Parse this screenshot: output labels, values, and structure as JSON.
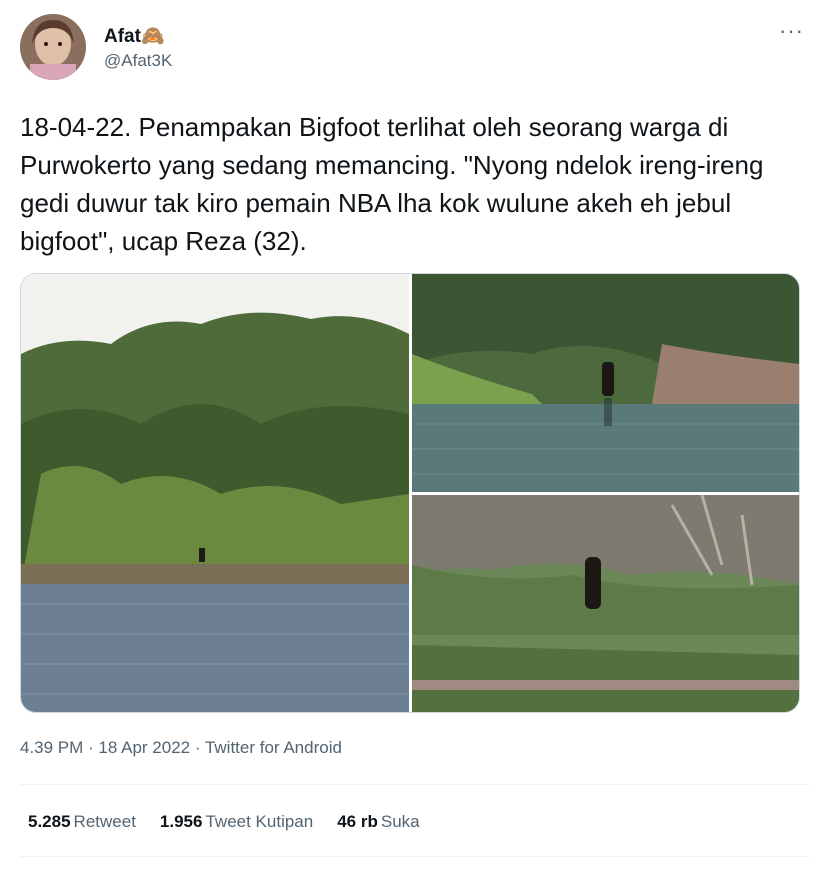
{
  "author": {
    "name": "Afat🙈",
    "handle": "@Afat3K",
    "avatar_icon": "user-avatar"
  },
  "more_icon": "more-horizontal-icon",
  "more_label": "···",
  "tweet": {
    "text": "18-04-22. Penampakan Bigfoot terlihat oleh seorang warga di Purwokerto yang sedang memancing. \"Nyong ndelok ireng-ireng gedi duwur tak kiro pemain NBA lha kok wulune akeh eh jebul bigfoot\", ucap Reza (32)."
  },
  "media": [
    {
      "label": "lake-shore-forest-photo"
    },
    {
      "label": "lake-shore-figure-photo"
    },
    {
      "label": "forest-clearing-figure-photo"
    }
  ],
  "meta": {
    "time": "4.39 PM",
    "sep1": " · ",
    "date": "18 Apr 2022",
    "sep2": " · ",
    "source": "Twitter for Android"
  },
  "stats": {
    "retweets_count": "5.285",
    "retweets_label": "Retweet",
    "quotes_count": "1.956",
    "quotes_label": "Tweet Kutipan",
    "likes_count": "46 rb",
    "likes_label": "Suka"
  },
  "colors": {
    "text_primary": "#0f1419",
    "text_secondary": "#536471",
    "border": "#cfd9de",
    "divider": "#eff3f4"
  }
}
